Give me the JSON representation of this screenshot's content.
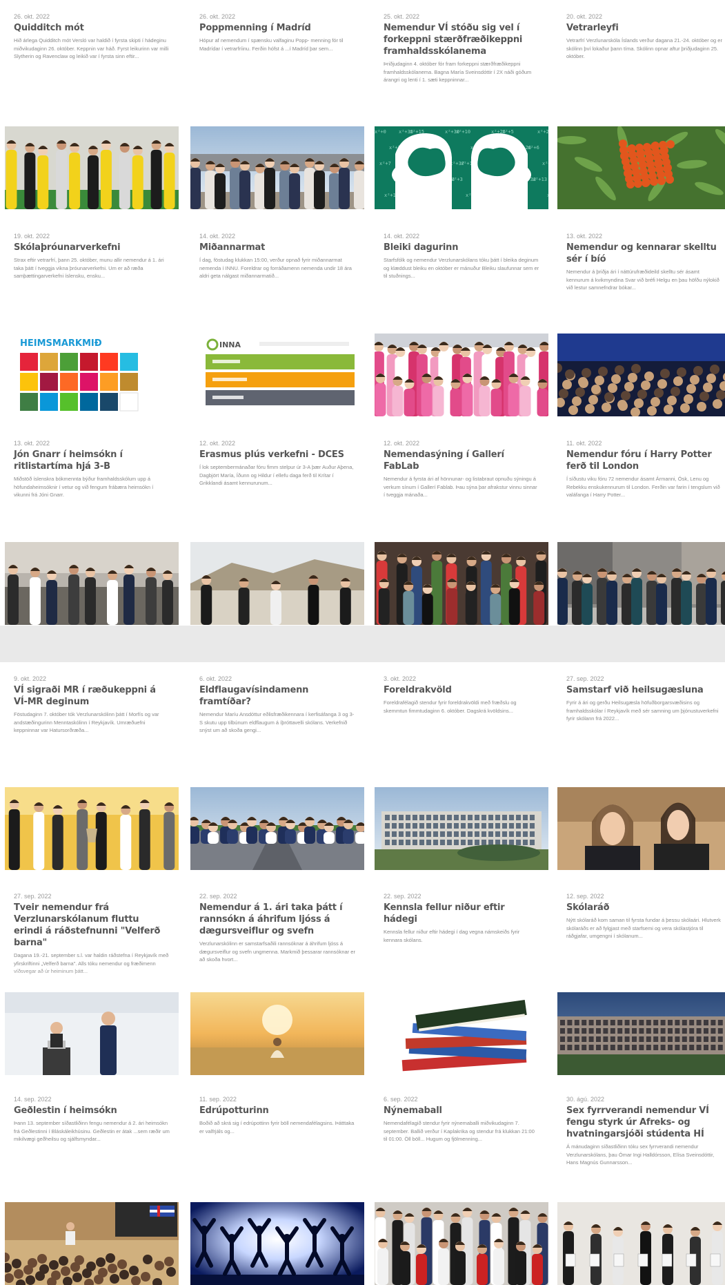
{
  "rows": [
    [
      {
        "date": "26. okt. 2022",
        "title": "Quidditch mót",
        "excerpt": "Hið árlega Quidditch mót Versló var haldið í fyrsta skipti í hádeginu miðvikudaginn 26. október. Keppnin var háð. Fyrst leikurinn var milli Slytherin og Ravenclaw og leikið var í fyrsta sinn eftir..."
      },
      {
        "date": "26. okt. 2022",
        "title": "Poppmenning í Madríd",
        "excerpt": "Hópur af nemendum í spænsku valfaginu Popp- menning fór til Madrídar í vetrarfríinu. Ferðin hófst á ...í Madríd þar sem..."
      },
      {
        "date": "25. okt. 2022",
        "title": "Nemendur VÍ stóðu sig vel í forkeppni stærðfræðikeppni framhaldsskólanema",
        "excerpt": "Þriðjudaginn 4. október fór fram forkeppni stærðfræðikeppni framhaldsskólanema. Bagna María Sveinsdóttir í 2X náði góðum árangri og lenti í 1. sæti keppninnar..."
      },
      {
        "date": "20. okt. 2022",
        "title": "Vetrarleyfi",
        "excerpt": "Vetrarfrí Verzlunarskóla Íslands verður dagana 21.-24. október og er skólinn því lokaður þann tíma. Skólinn opnar aftur þriðjudaginn 25. október."
      }
    ],
    [
      {
        "date": "19. okt. 2022",
        "title": "Skólaþróunarverkefni",
        "excerpt": "Strax eftir vetrarfrí, þann 25. október, munu allir nemendur á 1. ári taka þátt í tveggja vikna þróunarverkefni. Um er að ræða samþættingarverkefni íslensku, ensku..."
      },
      {
        "date": "14. okt. 2022",
        "title": "Miðannarmat",
        "excerpt": "Í dag, föstudag klukkan 15:00, verður opnað fyrir miðannarmat nemenda í INNU. Foreldrar og forráðamenn nemenda undir 18 ára aldri geta nálgast miðannarmatið..."
      },
      {
        "date": "14. okt. 2022",
        "title": "Bleiki dagurinn",
        "excerpt": "Starfsfólk og nemendur Verzlunarskólans tóku þátt í bleika deginum og klæddust bleiku en október er mánuður Bleiku slaufunnar sem er til stuðnings..."
      },
      {
        "date": "13. okt. 2022",
        "title": "Nemendur og kennarar skelltu sér í bíó",
        "excerpt": "Nemendur á þriðja ári í náttúrufræðideild skelltu sér ásamt kennurum á kvikmyndina Svar við bréfi Helgu en þau höfðu nýlokið við lestur samnefndrar bókar..."
      }
    ],
    [
      {
        "date": "13. okt. 2022",
        "title": "Jón Gnarr í heimsókn í ritlistartíma hjá 3-B",
        "excerpt": "Miðstöð íslenskra bókmennta býður framhaldsskólum upp á höfundaheimsóknir í vetur og við fengum frábæra heimsókn í vikunni frá Jóni Gnarr."
      },
      {
        "date": "12. okt. 2022",
        "title": "Erasmus plús verkefni - DCES",
        "excerpt": "Í lok septembermánaðar fóru fimm stelpur úr 3-A þær Auður Aþena, Dagbjört María, Íðunn og Hildur í ellefu daga ferð til Krítar í Grikklandi ásamt kennurunum..."
      },
      {
        "date": "12. okt. 2022",
        "title": "Nemendasýning í Gallerí FabLab",
        "excerpt": "Nemendur á fyrsta ári af hönnunar- og listabraut opnuðu sýningu á verkum sínum í Gallerí Fablab. Þau sýna þar afrakstur vinnu sinnar í tveggja mánaða..."
      },
      {
        "date": "11. okt. 2022",
        "title": "Nemendur fóru í Harry Potter ferð til London",
        "excerpt": "Í síðustu viku fóru 72 nemendur ásamt Ármanni, Ósk, Lenu og Rebekku enskukennurum til London. Ferðin var farin í tengslum við valáfanga í Harry Potter..."
      }
    ],
    [
      {
        "date": "9. okt. 2022",
        "title": "VÍ sigraði MR í ræðukeppni á VÍ-MR deginum",
        "excerpt": "Föstudaginn 7. október tók Verzlunarskólinn þátt í Morfís og var andstæðingurinn Menntaskólinn í Reykjavík. Umræðuefni keppninnar var Hatursorðræða..."
      },
      {
        "date": "6. okt. 2022",
        "title": "Eldflaugavísindamenn framtíðar?",
        "excerpt": "Nemendur Maríu Ansdóttur eðlisfræðikennara í kerfisáfanga 3 og 3-S skutu upp tilbúnum eldflaugum á íþróttavelli skólans. Verkefnið snýst um að skoða gengi..."
      },
      {
        "date": "3. okt. 2022",
        "title": "Foreldrakvöld",
        "excerpt": "Foreldrafélagið stendur fyrir foreldrakvöldi með fræðslu og skemmtun fimmtudaginn 6. október. Dagskrá kvöldsins..."
      },
      {
        "date": "27. sep. 2022",
        "title": "Samstarf við heilsugæsluna",
        "excerpt": "Fyrir á ári og gerðu Heilsugæsla höfuðborgarsvæðisins og framhaldsskólar í Reykjavík með sér samning um þjónustuverkefni fyrir skólann frá 2022..."
      }
    ],
    [
      {
        "date": "27. sep. 2022",
        "title": "Tveir nemendur frá Verzlunarskólanum fluttu erindi á ráðstefnunni \"Velferð barna\"",
        "excerpt": "Dagana 19.-21. september s.l. var haldin ráðstefna í Reykjavík með yfirskriftinni „Velferð barna\". Alls tóku nemendur og fræðimenn víðsvegar að úr heiminum þátt..."
      },
      {
        "date": "22. sep. 2022",
        "title": "Nemendur á 1. ári taka þátt í rannsókn á áhrifum ljóss á dægursveiflur og svefn",
        "excerpt": "Verzlunarskólinn er samstarfsaðili rannsóknar á áhrifum ljóss á dægursveiflur og svefn ungmenna. Markmið þessarar rannsóknar er að skoða hvort..."
      },
      {
        "date": "22. sep. 2022",
        "title": "Kennsla fellur niður eftir hádegi",
        "excerpt": "Kennsla fellur niður eftir hádegi í dag vegna námskeiðs fyrir kennara skólans."
      },
      {
        "date": "12. sep. 2022",
        "title": "Skólaráð",
        "excerpt": "Nýtt skólaráð kom saman til fyrsta fundar á þessu skólaári. Hlutverk skólaráðs er að fylgjast með starfsemi og vera skólastjóra til ráðgjafar, umgengni í skólanum..."
      }
    ],
    [
      {
        "date": "14. sep. 2022",
        "title": "Geðlestin í heimsókn",
        "excerpt": "Þann 13. september síðastliðinn fengu nemendur á 2. ári heimsókn frá Geðlestinni í Bláskáleikhúsinu. Geðlestin er átak ...sem ræðir um mikilvægi geðheilsu og sjálfsmyndar..."
      },
      {
        "date": "11. sep. 2022",
        "title": "Edrúpotturinn",
        "excerpt": "Boðið að skrá sig í edrúpottinn fyrir böll nemendafélagsins. Þátttaka er valfrjáls og..."
      },
      {
        "date": "6. sep. 2022",
        "title": "Nýnemaball",
        "excerpt": "Nemendafélagið stendur fyrir nýnemaballi miðvikudaginn 7. september. Ballið verður í Kaplakrika og stendur frá klukkan 21:00 til 01:00. Öll böll... Hugum og fjölmenning..."
      },
      {
        "date": "30. ágú. 2022",
        "title": "Sex fyrrverandi nemendur VÍ fengu styrk úr Afreks- og hvatningarsjóði stúdenta HÍ",
        "excerpt": "Á mánudaginn síðastliðinn tóku sex fyrrverandi nemendur Verzlunarskólans, þau Ómar Ingi Halldórsson, Elísa Sveinsdóttir, Hans Magnús Gunnarsson..."
      }
    ]
  ],
  "images": {
    "quidditch": "group-photo-yellow-shirts",
    "madrid": "group-photo-city",
    "math": "two-heads-silhouette-math",
    "rowan": "rowan-berries",
    "goals": "global-goals-grid",
    "inna": "inna-screenshot",
    "pink": "pink-day-group",
    "cinema": "cinema-audience",
    "gnarr": "classroom-students",
    "erasmus": "girls-on-cliff",
    "fablab": "gallery-group",
    "london": "london-group",
    "debate": "debate-team-trophy",
    "rocket": "students-on-track",
    "building": "school-building",
    "clinic": "two-women-portrait",
    "speakers": "two-presenters",
    "sunlight": "person-sunrise-meadow",
    "books": "stack-of-books",
    "building2": "school-building-evening",
    "hall": "auditorium-performance",
    "jump": "jumping-silhouettes",
    "ball": "crowd-of-students",
    "awards": "students-with-awards"
  },
  "inna_logo": "INNA"
}
